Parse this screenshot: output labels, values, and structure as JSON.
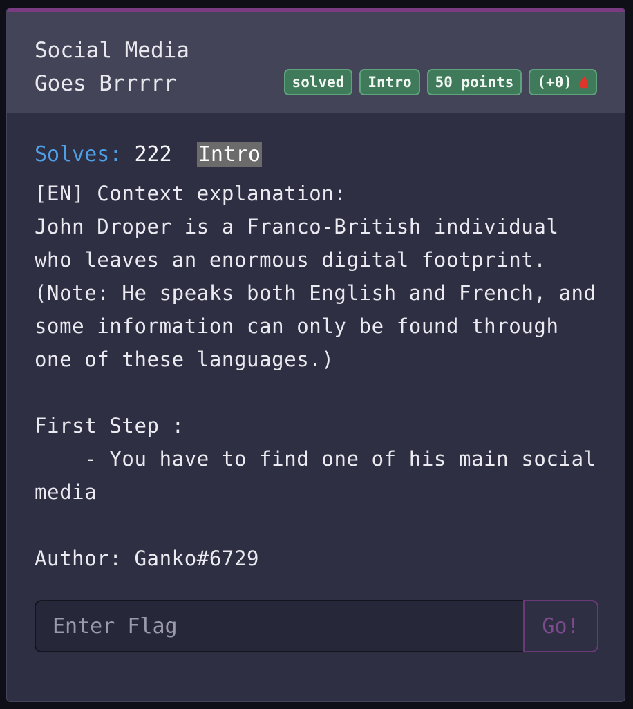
{
  "challenge": {
    "title": "Social Media\nGoes Brrrrr",
    "badges": {
      "status": "solved",
      "category": "Intro",
      "points": "50 points",
      "bonus": "(+0)"
    },
    "solves_label": "Solves:",
    "solves_count": "222",
    "category_chip": "Intro",
    "description": "[EN] Context explanation:\nJohn Droper is a Franco-British individual who leaves an enormous digital footprint. (Note: He speaks both English and French, and some information can only be found through one of these languages.)\n\nFirst Step :\n    - You have to find one of his main social media\n\nAuthor: Ganko#6729",
    "flag_input": {
      "placeholder": "Enter Flag",
      "value": ""
    },
    "submit_label": "Go!"
  },
  "icons": {
    "bonus_icon": "blood-drop-icon"
  },
  "colors": {
    "accent": "#7a3b82",
    "badge_bg": "#3f7a5a",
    "solves_label": "#4ea0e6",
    "blood_drop": "#e0352b"
  }
}
